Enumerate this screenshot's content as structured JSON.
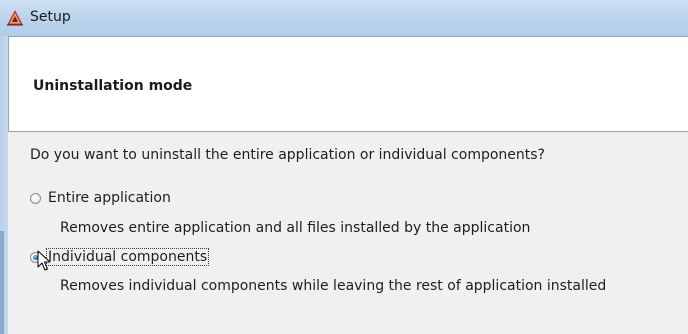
{
  "window": {
    "title": "Setup",
    "icon": "setup-app-icon"
  },
  "header": {
    "title": "Uninstallation mode"
  },
  "content": {
    "question": "Do you want to uninstall the entire application or individual components?",
    "options": [
      {
        "label": "Entire application",
        "description": "Removes entire application and all files installed by the application",
        "selected": false
      },
      {
        "label": "Individual components",
        "description": "Removes individual components while leaving the rest of application installed",
        "selected": true
      }
    ]
  },
  "colors": {
    "titlebar": "#bcd4ec",
    "content_background": "#f0f0f0",
    "header_background": "#ffffff",
    "radio_selected": "#2a6ec2"
  }
}
